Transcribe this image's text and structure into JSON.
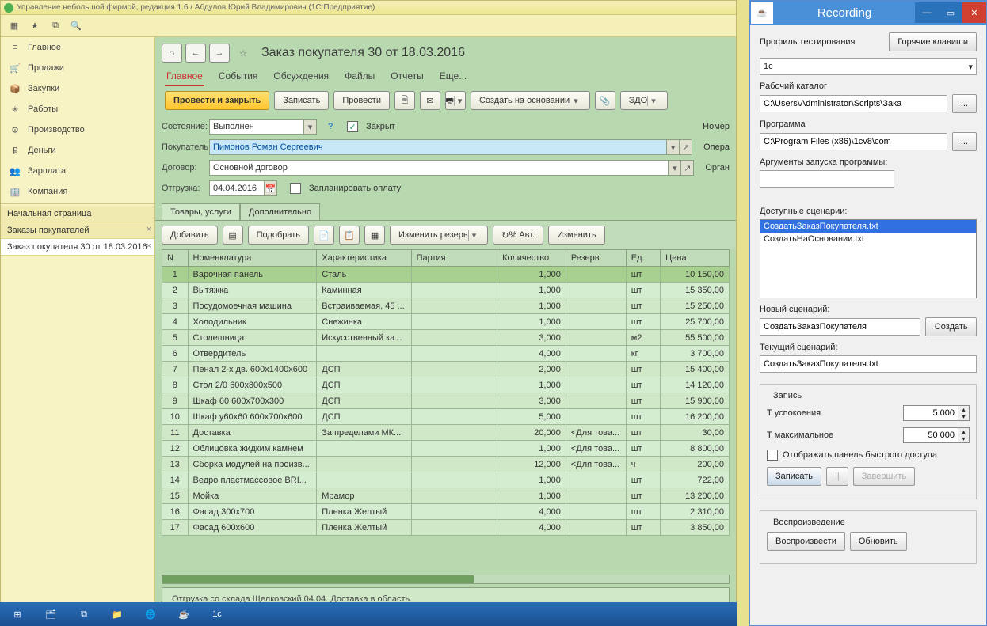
{
  "app": {
    "title": "Управление небольшой фирмой, редакция 1.6 / Абдулов Юрий Владимирович (1С:Предприятие)"
  },
  "sidebar": {
    "items": [
      {
        "icon": "≡",
        "label": "Главное"
      },
      {
        "icon": "🛒",
        "label": "Продажи"
      },
      {
        "icon": "📦",
        "label": "Закупки"
      },
      {
        "icon": "✳",
        "label": "Работы"
      },
      {
        "icon": "⚙",
        "label": "Производство"
      },
      {
        "icon": "₽",
        "label": "Деньги"
      },
      {
        "icon": "👥",
        "label": "Зарплата"
      },
      {
        "icon": "🏢",
        "label": "Компания"
      }
    ],
    "open": [
      {
        "label": "Начальная страница",
        "closable": false
      },
      {
        "label": "Заказы покупателей",
        "closable": true
      },
      {
        "label": "Заказ покупателя 30 от 18.03.2016",
        "closable": true
      }
    ]
  },
  "page": {
    "title": "Заказ покупателя 30 от 18.03.2016",
    "tabs": [
      "Главное",
      "События",
      "Обсуждения",
      "Файлы",
      "Отчеты",
      "Еще..."
    ],
    "activeTab": 0,
    "cmd": {
      "post_close": "Провести и закрыть",
      "write": "Записать",
      "post": "Провести",
      "create_based": "Создать на основании",
      "edo": "ЭДО"
    },
    "fields": {
      "state_label": "Состояние:",
      "state_value": "Выполнен",
      "closed_label": "Закрыт",
      "buyer_label": "Покупатель:",
      "buyer_value": "Пимонов Роман Сергеевич",
      "contract_label": "Договор:",
      "contract_value": "Основной договор",
      "ship_label": "Отгрузка:",
      "ship_date": "04.04.2016",
      "plan_pay": "Запланировать оплату",
      "number_label": "Номер",
      "oper_label": "Опера",
      "org_label": "Орган"
    },
    "subtabs": [
      "Товары, услуги",
      "Дополнительно"
    ],
    "activeSub": 0,
    "cmd2": {
      "add": "Добавить",
      "pick": "Подобрать",
      "change_reserve": "Изменить резерв",
      "pct_auto": "% Авт.",
      "change": "Изменить"
    },
    "columns": [
      "N",
      "Номенклатура",
      "Характеристика",
      "Партия",
      "Количество",
      "Резерв",
      "Ед.",
      "Цена"
    ],
    "rows": [
      {
        "n": "1",
        "nom": "Варочная панель",
        "char": "Сталь",
        "party": "",
        "qty": "1,000",
        "res": "",
        "unit": "шт",
        "price": "10 150,00"
      },
      {
        "n": "2",
        "nom": "Вытяжка",
        "char": "Каминная",
        "party": "",
        "qty": "1,000",
        "res": "",
        "unit": "шт",
        "price": "15 350,00"
      },
      {
        "n": "3",
        "nom": "Посудомоечная машина",
        "char": "Встраиваемая, 45 ...",
        "party": "",
        "qty": "1,000",
        "res": "",
        "unit": "шт",
        "price": "15 250,00"
      },
      {
        "n": "4",
        "nom": "Холодильник",
        "char": "Снежинка",
        "party": "",
        "qty": "1,000",
        "res": "",
        "unit": "шт",
        "price": "25 700,00"
      },
      {
        "n": "5",
        "nom": "Столешница",
        "char": "Искусственный ка...",
        "party": "",
        "qty": "3,000",
        "res": "",
        "unit": "м2",
        "price": "55 500,00"
      },
      {
        "n": "6",
        "nom": "Отвердитель",
        "char": "",
        "party": "",
        "qty": "4,000",
        "res": "",
        "unit": "кг",
        "price": "3 700,00"
      },
      {
        "n": "7",
        "nom": "Пенал 2-х дв. 600х1400х600",
        "char": "ДСП",
        "party": "",
        "qty": "2,000",
        "res": "",
        "unit": "шт",
        "price": "15 400,00"
      },
      {
        "n": "8",
        "nom": "Стол 2/0 600х800х500",
        "char": "ДСП",
        "party": "",
        "qty": "1,000",
        "res": "",
        "unit": "шт",
        "price": "14 120,00"
      },
      {
        "n": "9",
        "nom": "Шкаф 60 600х700х300",
        "char": "ДСП",
        "party": "",
        "qty": "3,000",
        "res": "",
        "unit": "шт",
        "price": "15 900,00"
      },
      {
        "n": "10",
        "nom": "Шкаф у60х60 600х700х600",
        "char": "ДСП",
        "party": "",
        "qty": "5,000",
        "res": "",
        "unit": "шт",
        "price": "16 200,00"
      },
      {
        "n": "11",
        "nom": "Доставка",
        "char": "За пределами МК...",
        "party": "",
        "qty": "20,000",
        "res": "<Для това...",
        "unit": "шт",
        "price": "30,00"
      },
      {
        "n": "12",
        "nom": "Облицовка жидким камнем",
        "char": "",
        "party": "",
        "qty": "1,000",
        "res": "<Для това...",
        "unit": "шт",
        "price": "8 800,00"
      },
      {
        "n": "13",
        "nom": "Сборка модулей на произв...",
        "char": "",
        "party": "",
        "qty": "12,000",
        "res": "<Для това...",
        "unit": "ч",
        "price": "200,00"
      },
      {
        "n": "14",
        "nom": "Ведро пластмассовое BRI...",
        "char": "",
        "party": "",
        "qty": "1,000",
        "res": "",
        "unit": "шт",
        "price": "722,00"
      },
      {
        "n": "15",
        "nom": "Мойка",
        "char": "Мрамор",
        "party": "",
        "qty": "1,000",
        "res": "",
        "unit": "шт",
        "price": "13 200,00"
      },
      {
        "n": "16",
        "nom": "Фасад 300х700",
        "char": "Пленка Желтый",
        "party": "",
        "qty": "4,000",
        "res": "",
        "unit": "шт",
        "price": "2 310,00"
      },
      {
        "n": "17",
        "nom": "Фасад 600х600",
        "char": "Пленка Желтый",
        "party": "",
        "qty": "4,000",
        "res": "",
        "unit": "шт",
        "price": "3 850,00"
      }
    ],
    "footer": "Отгрузка со склада Щелковский 04.04. Доставка в область."
  },
  "recording": {
    "title": "Recording",
    "profile_label": "Профиль тестирования",
    "hotkeys": "Горячие клавиши",
    "profile_value": "1с",
    "workdir_label": "Рабочий каталог",
    "workdir_value": "C:\\Users\\Administrator\\Scripts\\Зака",
    "browse": "...",
    "program_label": "Программа",
    "program_value": "C:\\Program Files (x86)\\1cv8\\com",
    "args_label": "Аргументы запуска программы:",
    "args_value": "",
    "avail_label": "Доступные сценарии:",
    "scenarios": [
      "СоздатьЗаказПокупателя.txt",
      "СоздатьНаОсновании.txt"
    ],
    "new_label": "Новый сценарий:",
    "new_value": "СоздатьЗаказПокупателя",
    "create": "Создать",
    "current_label": "Текущий сценарий:",
    "current_value": "СоздатьЗаказПокупателя.txt",
    "record_group": "Запись",
    "t_settle": "Т успокоения",
    "t_settle_val": "5 000",
    "t_max": "Т максимальное",
    "t_max_val": "50 000",
    "show_qa": "Отображать панель быстрого доступа",
    "write": "Записать",
    "pause": "||",
    "finish": "Завершить",
    "play_group": "Воспроизведение",
    "play": "Воспроизвести",
    "refresh": "Обновить"
  },
  "taskbar_icons": [
    "⊞",
    "🗂",
    "⧉",
    "📁",
    "🌐",
    "☕",
    "1c"
  ]
}
